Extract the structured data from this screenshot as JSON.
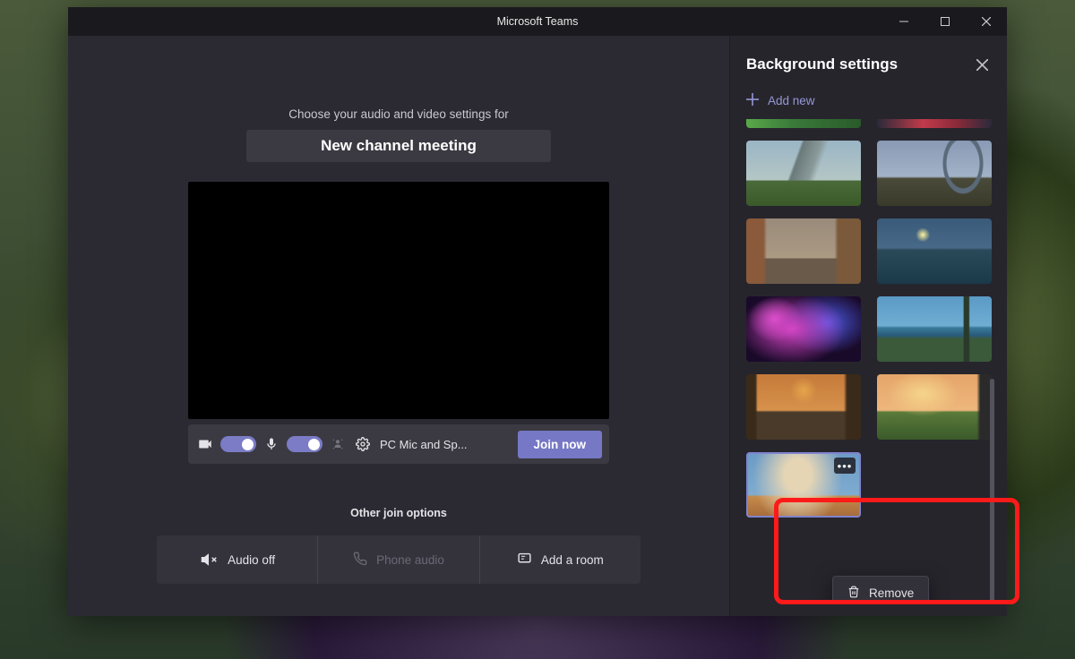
{
  "window": {
    "title": "Microsoft Teams"
  },
  "main": {
    "prompt": "Choose your audio and video settings for",
    "meeting_title": "New channel meeting",
    "device_label": "PC Mic and Sp...",
    "join_label": "Join now",
    "other_label": "Other join options",
    "options": {
      "audio_off": "Audio off",
      "phone_audio": "Phone audio",
      "add_room": "Add a room"
    }
  },
  "sidepanel": {
    "title": "Background settings",
    "add_new": "Add new",
    "remove": "Remove"
  }
}
